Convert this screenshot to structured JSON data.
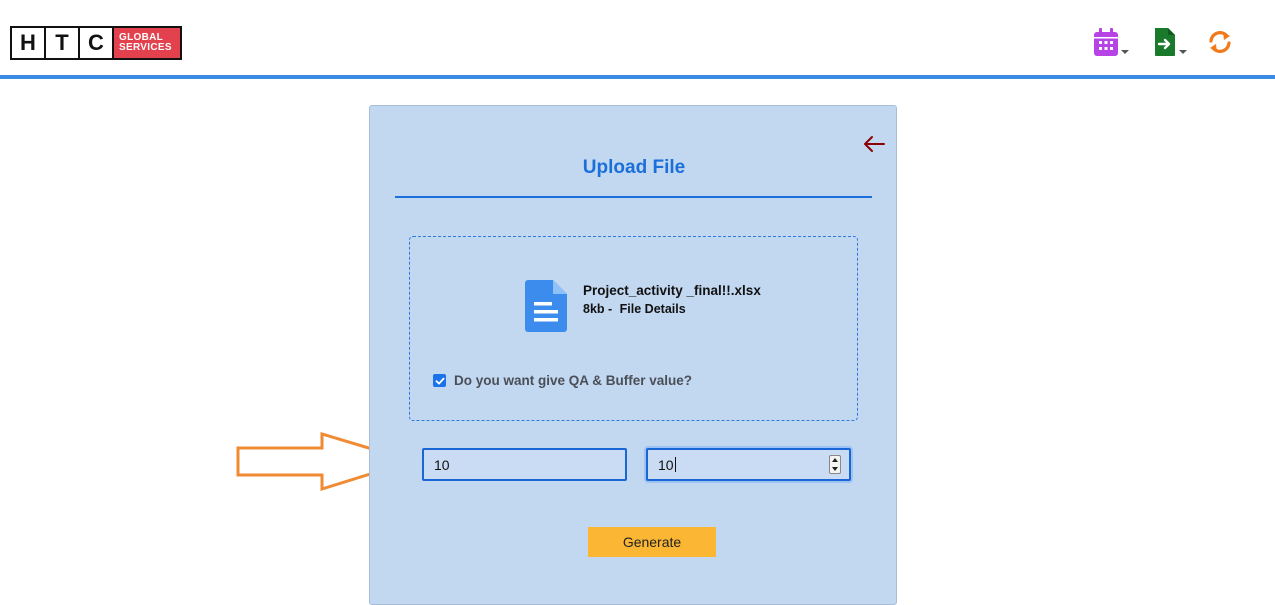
{
  "header": {
    "logo": {
      "letters": [
        "H",
        "T",
        "C"
      ],
      "brand_line1": "GLOBAL",
      "brand_line2": "SERVICES"
    },
    "icons": [
      {
        "name": "calendar-icon",
        "color": "#b743e6",
        "has_dropdown": true
      },
      {
        "name": "file-export-icon",
        "color": "#1a7a2c",
        "has_dropdown": true
      },
      {
        "name": "refresh-icon",
        "color": "#f07a1a",
        "has_dropdown": false
      }
    ],
    "accent_color": "#3b8be4"
  },
  "upload": {
    "title": "Upload File",
    "file": {
      "icon": "document-icon",
      "name": "Project_activity _final!!.xlsx",
      "size": "8kb -",
      "details_link": "File Details"
    },
    "checkbox": {
      "checked": true,
      "label": "Do you want give QA & Buffer value?"
    },
    "qa_input": {
      "value": "10"
    },
    "buffer_input": {
      "value": "10"
    },
    "generate_label": "Generate"
  },
  "colors": {
    "card_bg": "#c2d7f0",
    "title": "#1b6fd9",
    "button": "#fbb733",
    "annotation_arrow": "#f08a33",
    "back_arrow": "#8b0000"
  }
}
